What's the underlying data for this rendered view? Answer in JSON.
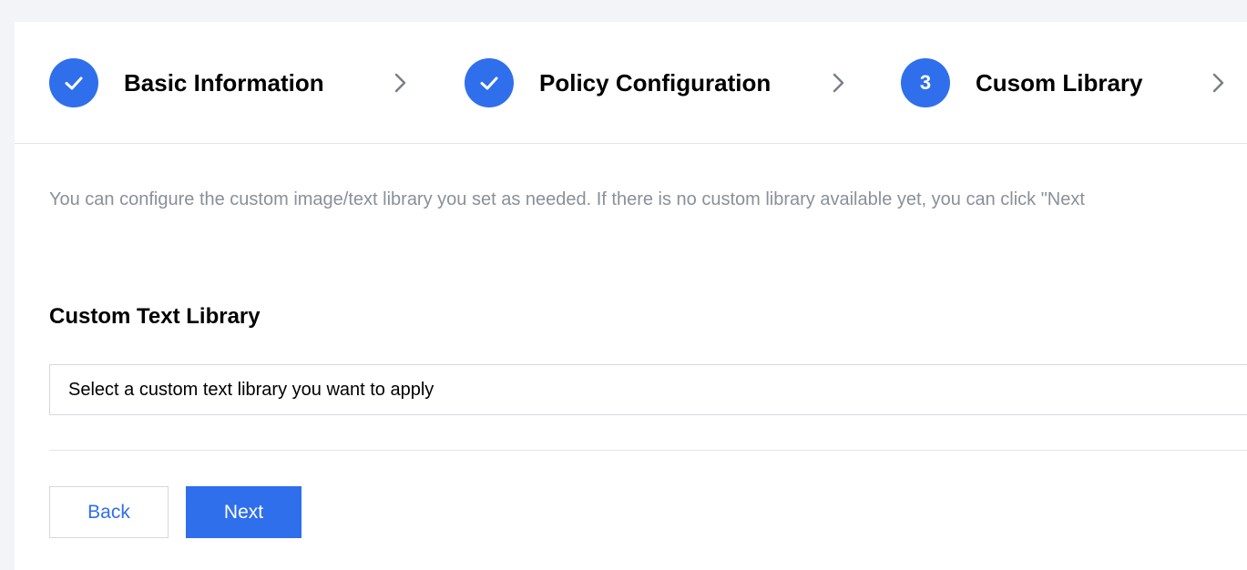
{
  "steps": [
    {
      "label": "Basic Information",
      "state": "done",
      "icon": "check-icon"
    },
    {
      "label": "Policy Configuration",
      "state": "done",
      "icon": "check-icon"
    },
    {
      "label": "Cusom Library",
      "state": "current",
      "number": "3"
    }
  ],
  "step_separator_icon": "chevron-right-icon",
  "intro_text": "You can configure the custom image/text library you set as needed. If there is no custom library available yet, you can click \"Next",
  "custom_text_library": {
    "title": "Custom Text Library",
    "placeholder": "Select a custom text library you want to apply"
  },
  "buttons": {
    "back_label": "Back",
    "next_label": "Next"
  },
  "colors": {
    "accent": "#2f6fec",
    "muted_text": "#8a8f99",
    "border": "#d6d8de",
    "background": "#f3f4f7"
  }
}
